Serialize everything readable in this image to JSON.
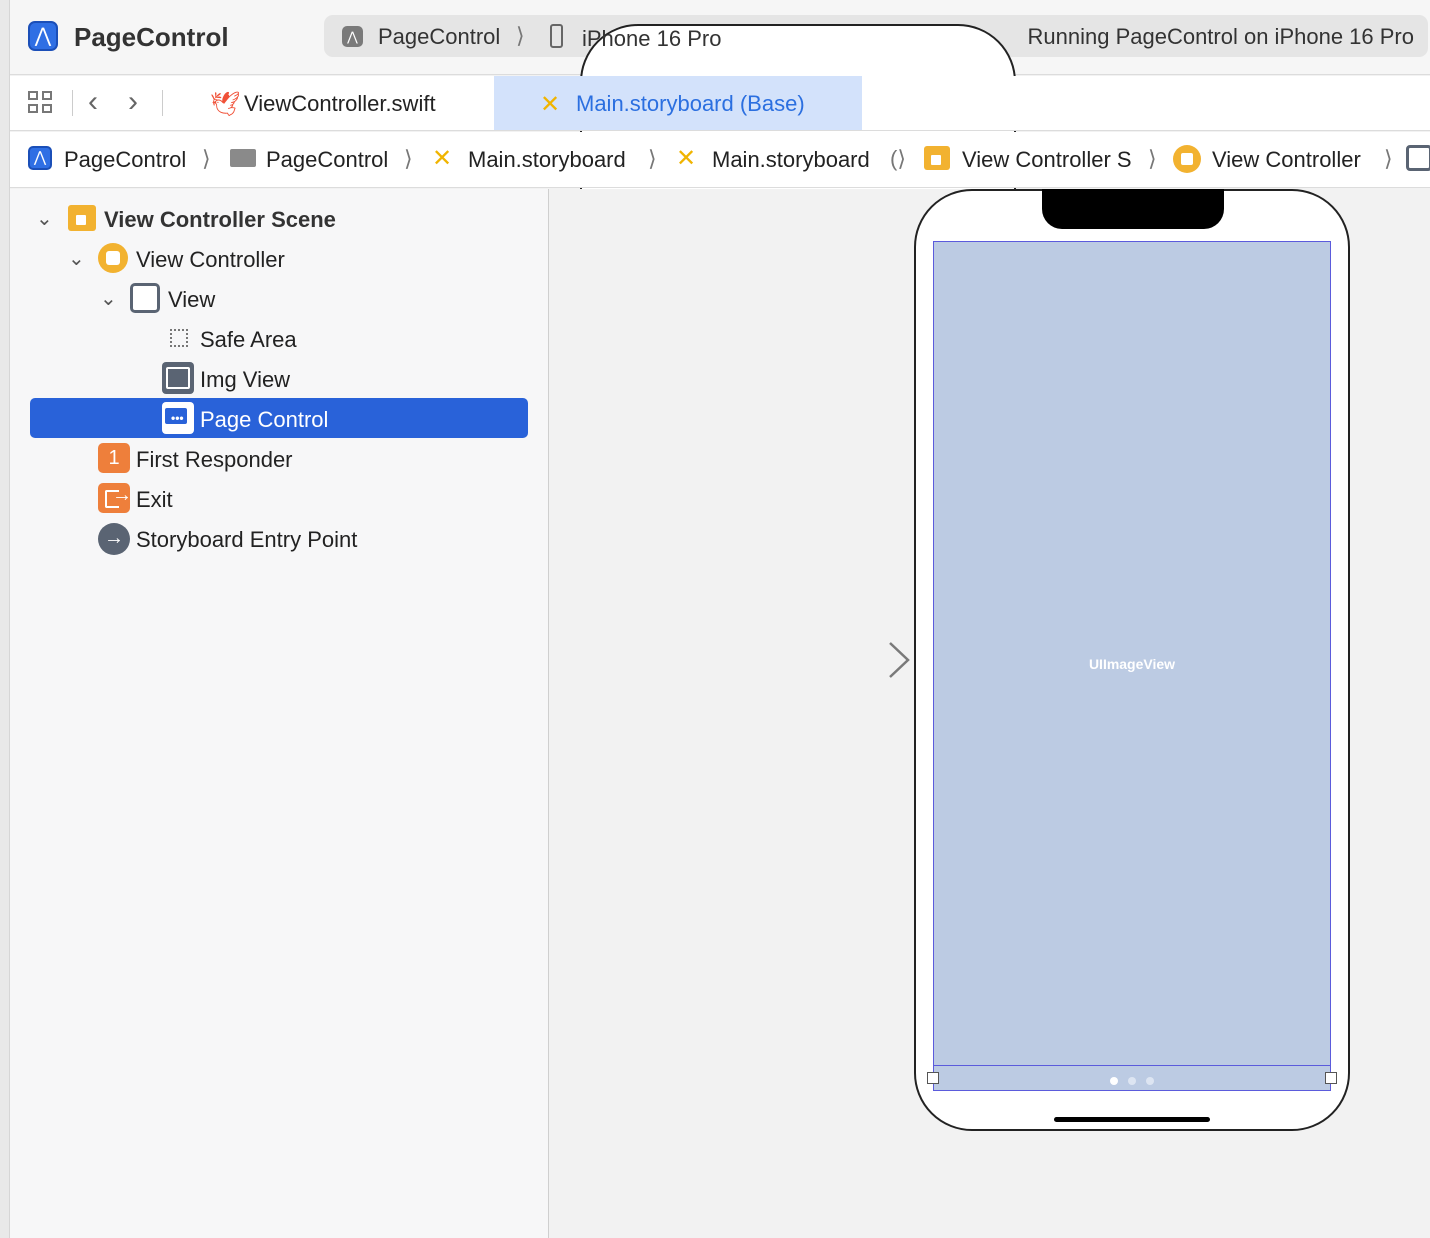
{
  "app": {
    "title": "PageControl",
    "icon": "xcode-project-icon"
  },
  "toolbar": {
    "scheme": "PageControl",
    "separator": "⟩",
    "device": "iPhone 16 Pro",
    "status": "Running PageControl on iPhone 16 Pro"
  },
  "tabs": [
    {
      "label": "ViewController.swift",
      "icon": "swift-icon",
      "active": false
    },
    {
      "label": "Main.storyboard (Base)",
      "icon": "storyboard-icon",
      "active": true
    }
  ],
  "breadcrumb": {
    "items": [
      "PageControl",
      "PageControl",
      "Main.storyboard",
      "Main.storyboard",
      "View Controller S",
      "View Controller"
    ],
    "sep": "⟩",
    "partial_sep": "(⟩"
  },
  "outline": {
    "items": [
      {
        "label": "View Controller Scene",
        "expanded": true,
        "level": 0
      },
      {
        "label": "View Controller",
        "expanded": true,
        "level": 1
      },
      {
        "label": "View",
        "expanded": true,
        "level": 2
      },
      {
        "label": "Safe Area",
        "level": 3
      },
      {
        "label": "Img View",
        "level": 3
      },
      {
        "label": "Page Control",
        "level": 3,
        "selected": true
      },
      {
        "label": "First Responder",
        "level": 1,
        "badge": "1"
      },
      {
        "label": "Exit",
        "level": 1
      },
      {
        "label": "Storyboard Entry Point",
        "level": 1
      }
    ]
  },
  "canvas": {
    "image_view_label": "UIImageView",
    "page_control": {
      "pages": 3,
      "current_page": 1
    }
  },
  "colors": {
    "accent": "#2962d9",
    "selection_tab": "#d3e2fb",
    "image_view_fill": "#bccbe3",
    "outline_border": "#5b5bdc",
    "storyboard_icon": "#f0b400",
    "scene_icon": "#f2b230",
    "responder_icon": "#ee7f3b"
  }
}
